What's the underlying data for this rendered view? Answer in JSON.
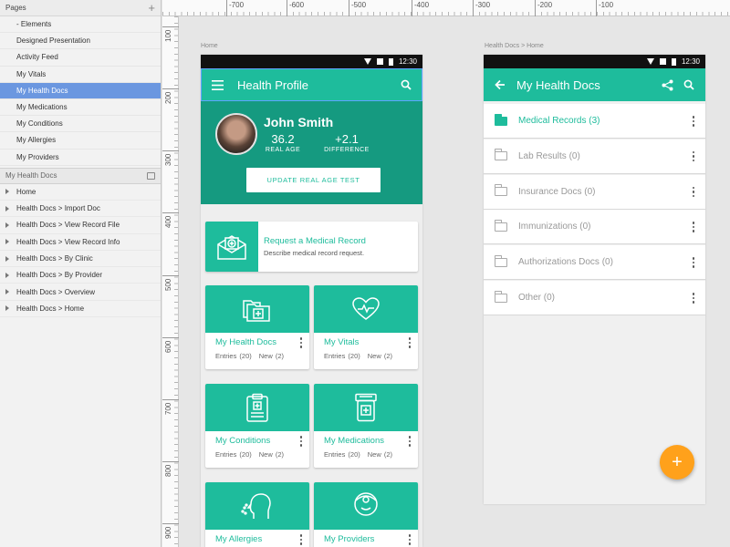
{
  "sidebar": {
    "pages_header": "Pages",
    "pages": [
      {
        "label": "- Elements",
        "active": false
      },
      {
        "label": "Designed Presentation",
        "active": false
      },
      {
        "label": "Activity Feed",
        "active": false
      },
      {
        "label": "My Vitals",
        "active": false
      },
      {
        "label": "My Health Docs",
        "active": true
      },
      {
        "label": "My Medications",
        "active": false
      },
      {
        "label": "My Conditions",
        "active": false
      },
      {
        "label": "My Allergies",
        "active": false
      },
      {
        "label": "My Providers",
        "active": false
      }
    ],
    "section_header": "My Health Docs",
    "artboards": [
      "Home",
      "Health Docs > Import Doc",
      "Health Docs > View Record File",
      "Health Docs > View Record Info",
      "Health Docs > By Clinic",
      "Health Docs > By Provider",
      "Health Docs > Overview",
      "Health Docs > Home"
    ]
  },
  "ruler": {
    "top": [
      "-700",
      "-600",
      "-500",
      "-400",
      "-300",
      "-200",
      "-100"
    ],
    "left": [
      "100",
      "200",
      "300",
      "400",
      "500",
      "600",
      "700",
      "800",
      "900"
    ]
  },
  "home": {
    "artboard_label": "Home",
    "time": "12:30",
    "title": "Health Profile",
    "profile": {
      "name": "John Smith",
      "real_age": "36.2",
      "real_age_label": "REAL AGE",
      "difference": "+2.1",
      "difference_label": "DIFFERENCE",
      "update_button": "UPDATE REAL AGE TEST"
    },
    "request": {
      "title": "Request a Medical Record",
      "description": "Describe medical record request."
    },
    "tiles": [
      {
        "title": "My Health Docs",
        "entries": "Entries (20)",
        "new": "New (2)",
        "icon": "folders-plus-icon"
      },
      {
        "title": "My Vitals",
        "entries": "Entries (20)",
        "new": "New (2)",
        "icon": "heart-pulse-icon"
      },
      {
        "title": "My Conditions",
        "entries": "Entries (20)",
        "new": "New (2)",
        "icon": "clipboard-icon"
      },
      {
        "title": "My Medications",
        "entries": "Entries (20)",
        "new": "New (2)",
        "icon": "pill-bottle-icon"
      },
      {
        "title": "My Allergies",
        "icon": "allergy-head-icon"
      },
      {
        "title": "My Providers",
        "icon": "doctor-icon"
      }
    ]
  },
  "docs": {
    "artboard_label": "Health Docs > Home",
    "time": "12:30",
    "title": "My Health Docs",
    "items": [
      {
        "label": "Medical Records (3)",
        "active": true
      },
      {
        "label": "Lab Results (0)",
        "active": false
      },
      {
        "label": "Insurance Docs (0)",
        "active": false
      },
      {
        "label": "Immunizations (0)",
        "active": false
      },
      {
        "label": "Authorizations Docs (0)",
        "active": false
      },
      {
        "label": "Other (0)",
        "active": false
      }
    ],
    "fab": "+"
  },
  "colors": {
    "accent": "#1ebc9c",
    "accent_dark": "#159a80",
    "fab": "#ffa11b",
    "selection": "#6b97e0"
  }
}
